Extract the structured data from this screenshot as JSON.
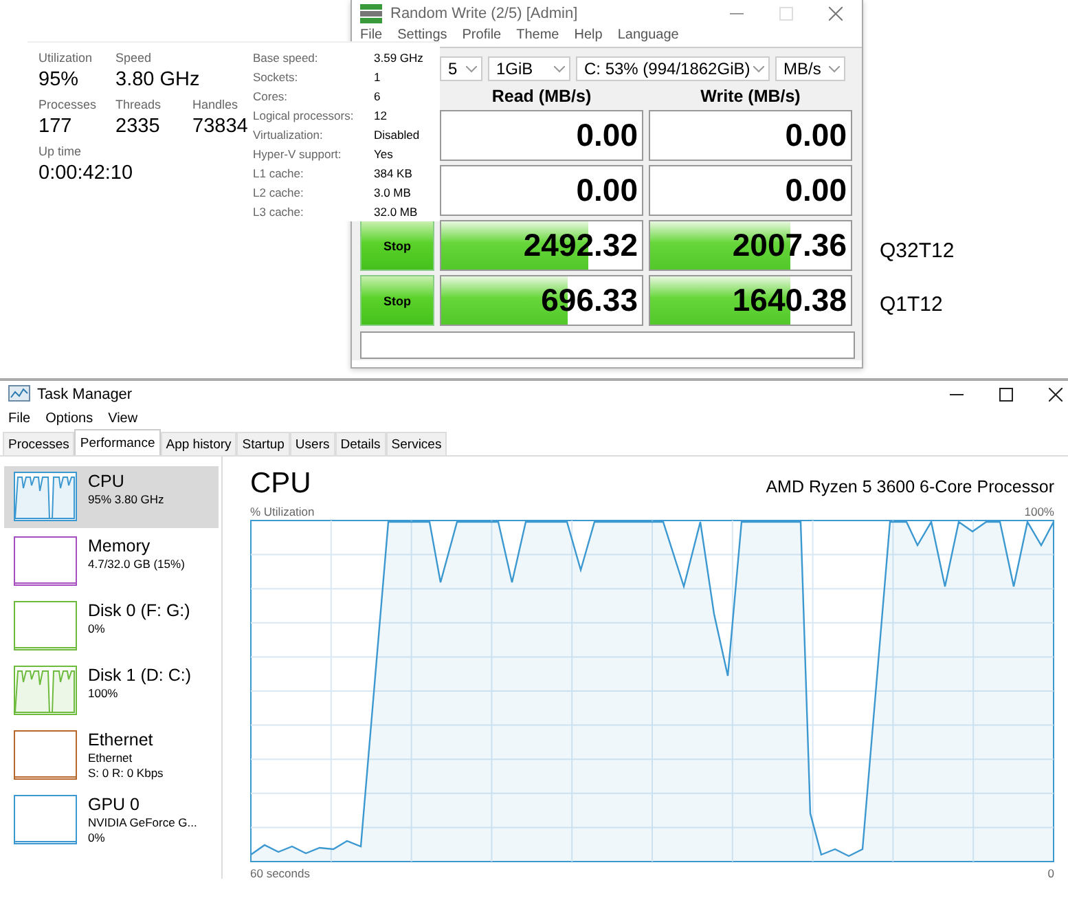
{
  "cpu_stats_panel": {
    "stat_rows": [
      [
        {
          "label": "Utilization",
          "value": "95%"
        },
        {
          "label": "Speed",
          "value": "3.80 GHz"
        }
      ],
      [
        {
          "label": "Processes",
          "value": "177"
        },
        {
          "label": "Threads",
          "value": "2335"
        },
        {
          "label": "Handles",
          "value": "73834"
        }
      ]
    ],
    "uptime": {
      "label": "Up time",
      "value": "0:00:42:10"
    },
    "details": [
      {
        "label": "Base speed:",
        "value": "3.59 GHz"
      },
      {
        "label": "Sockets:",
        "value": "1"
      },
      {
        "label": "Cores:",
        "value": "6"
      },
      {
        "label": "Logical processors:",
        "value": "12"
      },
      {
        "label": "Virtualization:",
        "value": "Disabled"
      },
      {
        "label": "Hyper-V support:",
        "value": "Yes"
      },
      {
        "label": "L1 cache:",
        "value": "384 KB"
      },
      {
        "label": "L2 cache:",
        "value": "3.0 MB"
      },
      {
        "label": "L3 cache:",
        "value": "32.0 MB"
      }
    ]
  },
  "benchmark_window": {
    "title": "Random Write (2/5) [Admin]",
    "menu": [
      "File",
      "Settings",
      "Profile",
      "Theme",
      "Help",
      "Language"
    ],
    "selectors": [
      "5",
      "1GiB",
      "C: 53% (994/1862GiB)",
      "MB/s"
    ],
    "columns": [
      "Read (MB/s)",
      "Write (MB/s)"
    ],
    "rows": [
      {
        "cells": [
          {
            "value": "0.00"
          },
          {
            "value": "0.00"
          }
        ]
      },
      {
        "cells": [
          {
            "value": "0.00"
          },
          {
            "value": "0.00"
          }
        ]
      },
      {
        "button": "Stop",
        "cells": [
          {
            "value": "2492.32",
            "level": 0.73
          },
          {
            "value": "2007.36",
            "level": 0.7
          }
        ]
      },
      {
        "button": "Stop",
        "cells": [
          {
            "value": "696.33",
            "level": 0.63
          },
          {
            "value": "1640.38",
            "level": 0.7
          }
        ]
      }
    ]
  },
  "test_labels": [
    "Q32T12",
    "Q1T12"
  ],
  "task_manager": {
    "title": "Task Manager",
    "menu": [
      "File",
      "Options",
      "View"
    ],
    "tabs": [
      {
        "label": "Processes",
        "selected": false
      },
      {
        "label": "Performance",
        "selected": true
      },
      {
        "label": "App history",
        "selected": false
      },
      {
        "label": "Startup",
        "selected": false
      },
      {
        "label": "Users",
        "selected": false
      },
      {
        "label": "Details",
        "selected": false
      },
      {
        "label": "Services",
        "selected": false
      }
    ],
    "sidebar": [
      {
        "name": "CPU",
        "details": [
          "95% 3.80 GHz"
        ],
        "color": "#3c98d0",
        "selected": true,
        "busy": true
      },
      {
        "name": "Memory",
        "details": [
          "4.7/32.0 GB (15%)"
        ],
        "color": "#a74ec0",
        "selected": false,
        "busy": false
      },
      {
        "name": "Disk 0 (F: G:)",
        "details": [
          "0%"
        ],
        "color": "#6cbb3c",
        "selected": false,
        "busy": false
      },
      {
        "name": "Disk 1 (D: C:)",
        "details": [
          "100%"
        ],
        "color": "#6cbb3c",
        "selected": false,
        "busy": true
      },
      {
        "name": "Ethernet",
        "details": [
          "Ethernet",
          "S: 0 R: 0 Kbps"
        ],
        "color": "#b8672a",
        "selected": false,
        "busy": false
      },
      {
        "name": "GPU 0",
        "details": [
          "NVIDIA GeForce G...",
          "0%"
        ],
        "color": "#3c98d0",
        "selected": false,
        "busy": false
      }
    ],
    "main": {
      "title": "CPU",
      "processor": "AMD Ryzen 5 3600 6-Core Processor",
      "y_label": "% Utilization",
      "y_max": "100%",
      "x_start": "60 seconds",
      "x_end": "0"
    }
  }
}
